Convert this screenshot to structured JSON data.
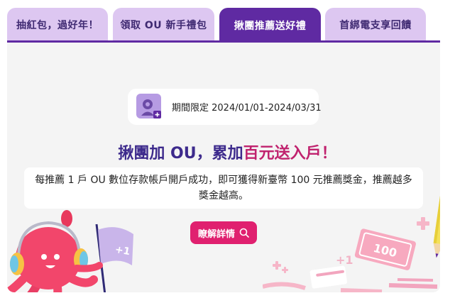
{
  "tabs": [
    {
      "label": "抽紅包，過好年！",
      "active": false
    },
    {
      "label": "領取 OU 新手禮包",
      "active": false
    },
    {
      "label": "揪團推薦送好禮",
      "active": true
    },
    {
      "label": "首綁電支享回饋",
      "active": false
    }
  ],
  "period": {
    "label": "期間限定 2024/01/01-2024/03/31",
    "icon": "user-add-icon"
  },
  "headline": {
    "part1": "揪團加 OU，累加",
    "part2": "百元送入戶！"
  },
  "description": {
    "line1": "每推薦 1 戶 OU 數位存款帳戶開戶成功，即可獲得新臺幣 100 元推薦獎金，推薦越多",
    "line2": "獎金越高。"
  },
  "cta": {
    "label": "瞭解詳情",
    "icon": "search-icon"
  },
  "decor": {
    "flag_text": "+1",
    "plus_text": "+1",
    "bill_text": "100"
  },
  "colors": {
    "tab_active": "#5f2aa2",
    "tab_inactive": "#ddc7f1",
    "headline": "#3d2a8c",
    "highlight": "#c0226e",
    "cta": "#e0206f"
  }
}
